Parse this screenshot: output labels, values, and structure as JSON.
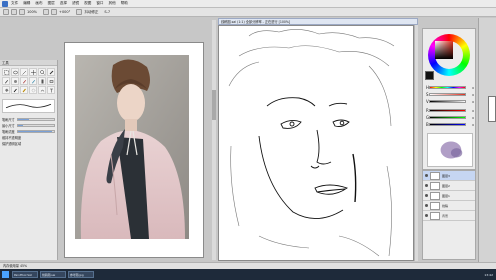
{
  "menubar": {
    "items": [
      "文件",
      "编辑",
      "画布",
      "图层",
      "选择",
      "滤镜",
      "视图",
      "窗口",
      "其他",
      "帮助"
    ]
  },
  "toolbar": {
    "zoom": "100%",
    "angle": "+000°",
    "stabilizer_label": "抖动修正",
    "stabilizer_value": "S-7"
  },
  "toolpanel": {
    "title": "工具",
    "props": [
      {
        "label": "笔刷尺寸",
        "value": 0.3
      },
      {
        "label": "最小尺寸",
        "value": 0.15
      },
      {
        "label": "笔刷浓度",
        "value": 0.95
      }
    ],
    "options": [
      "维持不透明度",
      "保护透明区域"
    ]
  },
  "canvas2": {
    "title": "线稿图.sai (1:1) 全部分辨率 - 正在进行 [100%]"
  },
  "color": {
    "hsv_values": [
      "H",
      "S",
      "V"
    ],
    "rgb_values": [
      "R",
      "G",
      "B"
    ],
    "slider_vals": [
      "0",
      "0",
      "0",
      "0",
      "0",
      "0"
    ],
    "primary": "#111111",
    "accent": "#e03020"
  },
  "layers": {
    "items": [
      {
        "name": "图层3",
        "selected": true
      },
      {
        "name": "图层2",
        "selected": false
      },
      {
        "name": "图层1",
        "selected": false
      },
      {
        "name": "线稿",
        "selected": false
      },
      {
        "name": "背景",
        "selected": false
      }
    ]
  },
  "statusbar": {
    "text": "内存使用量 45%"
  },
  "taskbar": {
    "apps": [
      "PaintTool SAI",
      "线稿图.sai",
      "参考图.jpg"
    ],
    "clock": "13:42"
  }
}
